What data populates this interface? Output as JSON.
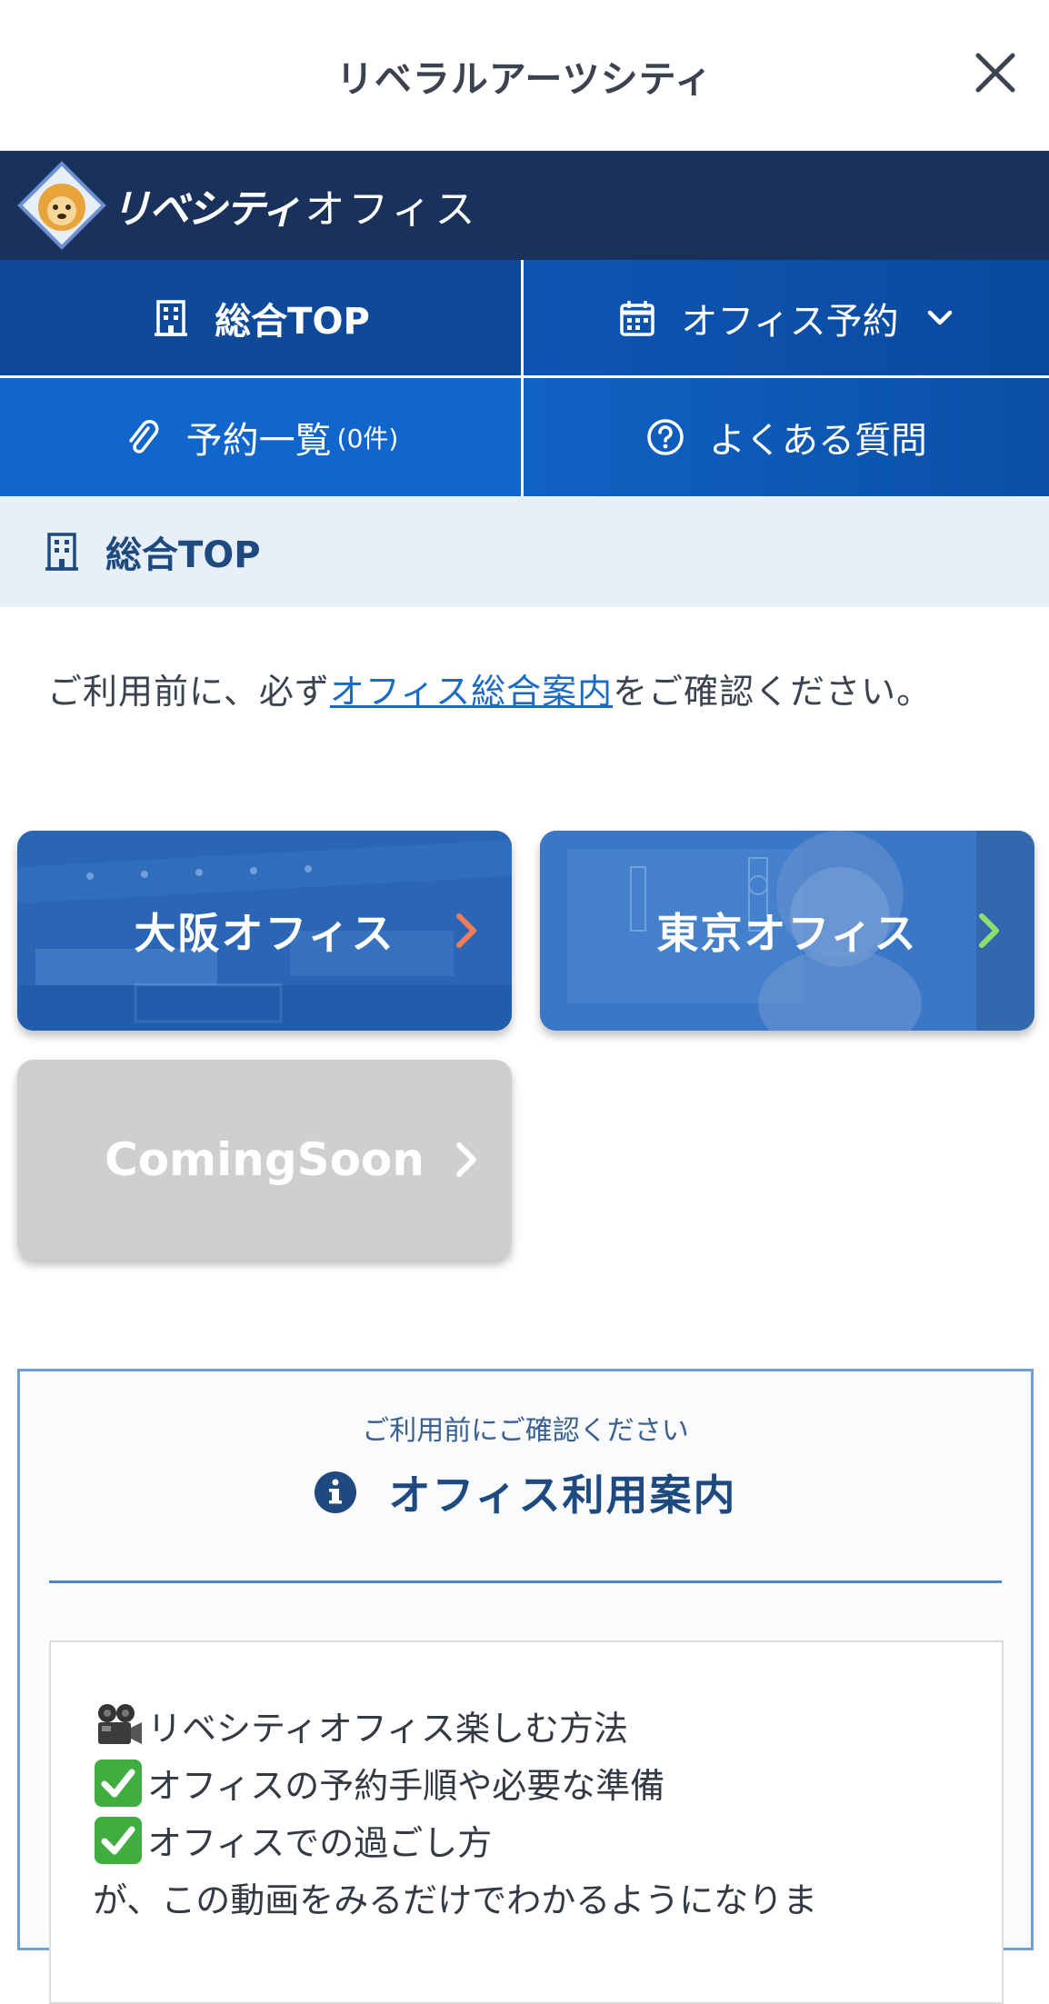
{
  "titlebar": {
    "title": "リベラルアーツシティ"
  },
  "brand": {
    "logo_bold": "リベシティ",
    "logo_light": "オフィス"
  },
  "nav": {
    "top": "総合TOP",
    "reserve": "オフィス予約",
    "list": "予約一覧",
    "list_count": "(0件)",
    "faq": "よくある質問"
  },
  "section": {
    "title": "総合TOP"
  },
  "notice": {
    "before": "ご利用前に、必ず",
    "link": "オフィス総合案内",
    "after": "をご確認ください。"
  },
  "cards": {
    "osaka": "大阪オフィス",
    "tokyo": "東京オフィス",
    "soon": "ComingSoon"
  },
  "colors": {
    "arrow_osaka": "#f07c5a",
    "arrow_tokyo": "#8fe06a",
    "nav_active": "#0f4a9a",
    "brand": "#19325c"
  },
  "info": {
    "subtitle": "ご利用前にご確認ください",
    "title": "オフィス利用案内",
    "lines": [
      {
        "icon": "movie-camera-icon",
        "text": "リベシティオフィス楽しむ方法"
      },
      {
        "icon": "check-mark-icon",
        "text": "オフィスの予約手順や必要な準備"
      },
      {
        "icon": "check-mark-icon",
        "text": "オフィスでの過ごし方"
      },
      {
        "icon": "",
        "text": "が、この動画をみるだけでわかるようになりま"
      }
    ]
  }
}
